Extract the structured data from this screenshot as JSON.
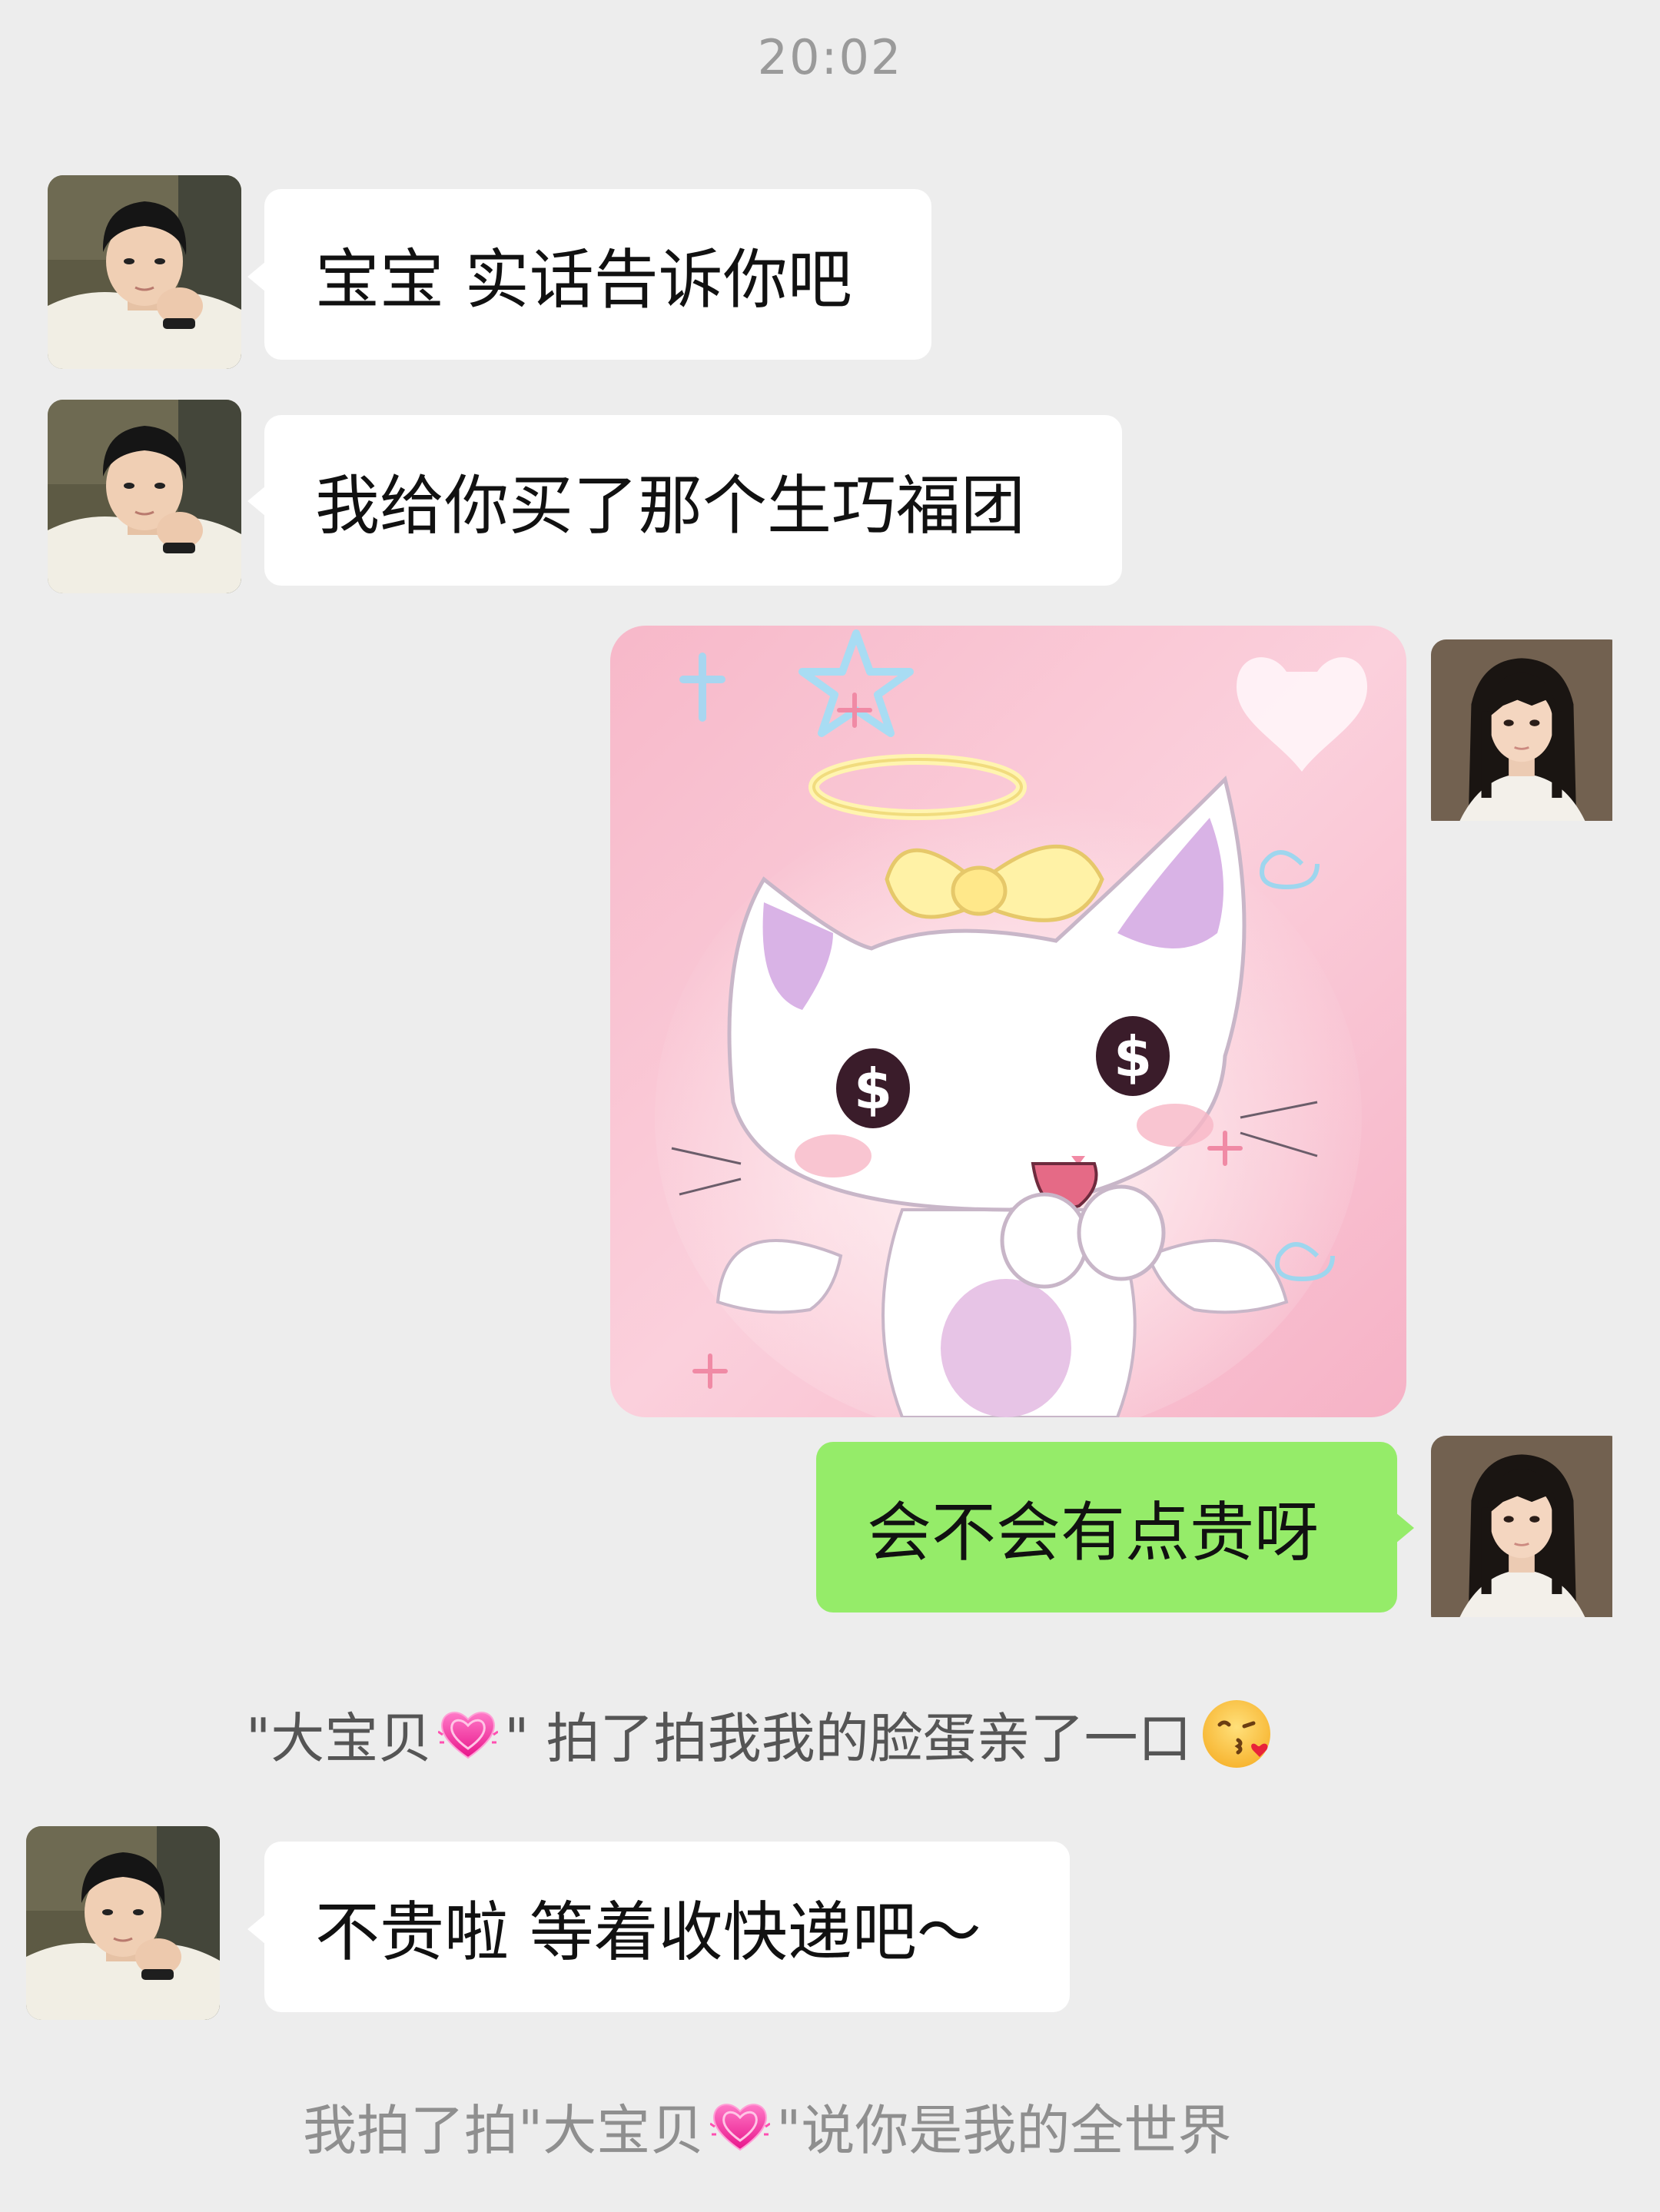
{
  "timestamp": "20:02",
  "messages": {
    "m1": "宝宝 实话告诉你吧",
    "m2": "我给你买了那个生巧福团",
    "m3": "会不会有点贵呀",
    "m5": "不贵啦 等着收快递吧～"
  },
  "system_1": {
    "prefix": "\"大宝贝",
    "suffix": "\" 拍了拍我我的脸蛋亲了一口",
    "heart_icon": "pink-heart-icon",
    "emoji_icon": "kissing-face-icon"
  },
  "system_2": {
    "prefix": "我拍了拍\"大宝贝",
    "suffix": "\"说你是我的全世界",
    "heart_icon": "pink-heart-icon"
  },
  "image_message": {
    "icon": "angel-cat-dollar-eyes-image"
  },
  "colors": {
    "background": "#ededed",
    "received_bubble": "#ffffff",
    "sent_bubble": "#95ec69",
    "timestamp_text": "#9a9a9a"
  }
}
